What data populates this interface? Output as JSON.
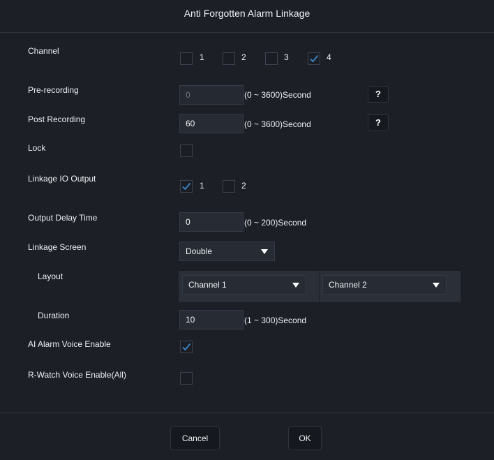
{
  "dialog": {
    "title": "Anti Forgotten Alarm Linkage"
  },
  "channel": {
    "label": "Channel",
    "options": [
      {
        "label": "1",
        "checked": false
      },
      {
        "label": "2",
        "checked": false
      },
      {
        "label": "3",
        "checked": false
      },
      {
        "label": "4",
        "checked": true
      }
    ]
  },
  "pre_recording": {
    "label": "Pre-recording",
    "value": "0",
    "unit": "(0 ~ 3600)Second",
    "help": "?"
  },
  "post_recording": {
    "label": "Post Recording",
    "value": "60",
    "unit": "(0 ~ 3600)Second",
    "help": "?"
  },
  "lock": {
    "label": "Lock",
    "checked": false
  },
  "linkage_io": {
    "label": "Linkage IO Output",
    "options": [
      {
        "label": "1",
        "checked": true
      },
      {
        "label": "2",
        "checked": false
      }
    ]
  },
  "output_delay": {
    "label": "Output Delay Time",
    "value": "0",
    "unit": "(0 ~ 200)Second"
  },
  "linkage_screen": {
    "label": "Linkage Screen",
    "value": "Double"
  },
  "layout": {
    "label": "Layout",
    "select1": "Channel 1",
    "select2": "Channel 2"
  },
  "duration": {
    "label": "Duration",
    "value": "10",
    "unit": "(1 ~ 300)Second"
  },
  "ai_voice": {
    "label": "AI Alarm Voice Enable",
    "checked": true
  },
  "rwatch_voice": {
    "label": "R-Watch Voice Enable(All)",
    "checked": false
  },
  "buttons": {
    "cancel": "Cancel",
    "ok": "OK"
  },
  "colors": {
    "check": "#3f86c4",
    "background": "#1c1f26"
  }
}
